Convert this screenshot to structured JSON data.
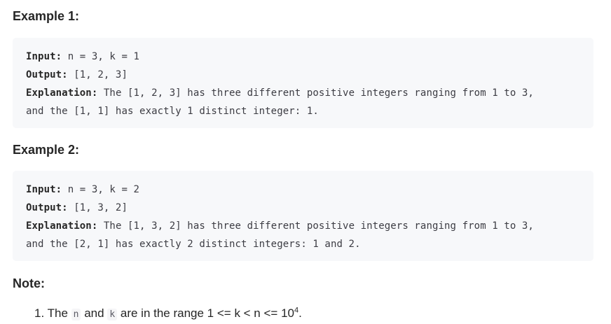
{
  "example1": {
    "title": "Example 1:",
    "input_label": "Input:",
    "input_value": " n = 3, k = 1",
    "output_label": "Output:",
    "output_value": " [1, 2, 3]",
    "explanation_label": "Explanation:",
    "explanation_line1": " The [1, 2, 3] has three different positive integers ranging from 1 to 3,",
    "explanation_line2": "and the [1, 1] has exactly 1 distinct integer: 1."
  },
  "example2": {
    "title": "Example 2:",
    "input_label": "Input:",
    "input_value": " n = 3, k = 2",
    "output_label": "Output:",
    "output_value": " [1, 3, 2]",
    "explanation_label": "Explanation:",
    "explanation_line1": " The [1, 3, 2] has three different positive integers ranging from 1 to 3,",
    "explanation_line2": "and the [2, 1] has exactly 2 distinct integers: 1 and 2."
  },
  "note": {
    "title": "Note:",
    "item_number": "1.",
    "text_the": "The",
    "code_n": "n",
    "text_and": "and",
    "code_k": "k",
    "text_range": "are in the range 1 <= k < n <= 10",
    "exponent": "4",
    "text_end": "."
  }
}
